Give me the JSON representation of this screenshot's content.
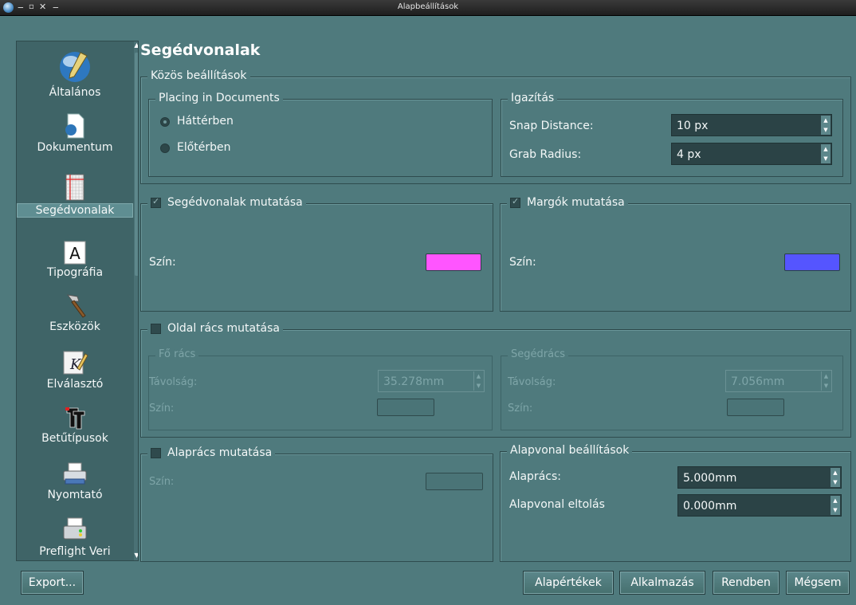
{
  "window": {
    "title": "Alapbeállítások"
  },
  "sidebar": {
    "items": [
      {
        "label": "Általános",
        "icon": "globe-pen-icon"
      },
      {
        "label": "Dokumentum",
        "icon": "document-icon"
      },
      {
        "label": "Segédvonalak",
        "icon": "guides-icon",
        "active": true
      },
      {
        "label": "Tipográfia",
        "icon": "letter-a-icon"
      },
      {
        "label": "Eszközök",
        "icon": "hammer-icon"
      },
      {
        "label": "Elválasztó",
        "icon": "pen-k-icon"
      },
      {
        "label": "Betűtípusok",
        "icon": "font-icon"
      },
      {
        "label": "Nyomtató",
        "icon": "printer-icon"
      },
      {
        "label": "Preflight Veri",
        "icon": "preflight-icon"
      }
    ]
  },
  "page": {
    "title": "Segédvonalak"
  },
  "common": {
    "legend": "Közös beállítások",
    "placing": {
      "legend": "Placing in Documents",
      "options": [
        "Háttérben",
        "Előtérben"
      ],
      "selected": "Háttérben"
    },
    "alignment": {
      "legend": "Igazítás",
      "snap_label": "Snap Distance:",
      "snap_value": "10 px",
      "grab_label": "Grab Radius:",
      "grab_value": "4 px"
    }
  },
  "guides": {
    "legend": "Segédvonalak mutatása",
    "checked": true,
    "color_label": "Szín:",
    "color": "#ff55ff"
  },
  "margins": {
    "legend": "Margók mutatása",
    "checked": true,
    "color_label": "Szín:",
    "color": "#5555ff"
  },
  "page_grid": {
    "legend": "Oldal rács mutatása",
    "checked": false,
    "major": {
      "legend": "Fő rács",
      "distance_label": "Távolság:",
      "distance_value": "35.278mm",
      "color_label": "Szín:"
    },
    "minor": {
      "legend": "Segédrács",
      "distance_label": "Távolság:",
      "distance_value": "7.056mm",
      "color_label": "Szín:"
    }
  },
  "baseline_grid": {
    "legend": "Alaprács mutatása",
    "checked": false,
    "color_label": "Szín:"
  },
  "baseline_settings": {
    "legend": "Alapvonal beállítások",
    "grid_label": "Alaprács:",
    "grid_value": "5.000mm",
    "offset_label": "Alapvonal eltolás",
    "offset_value": "0.000mm"
  },
  "buttons": {
    "export": "Export...",
    "defaults": "Alapértékek",
    "apply": "Alkalmazás",
    "ok": "Rendben",
    "cancel": "Mégsem"
  }
}
